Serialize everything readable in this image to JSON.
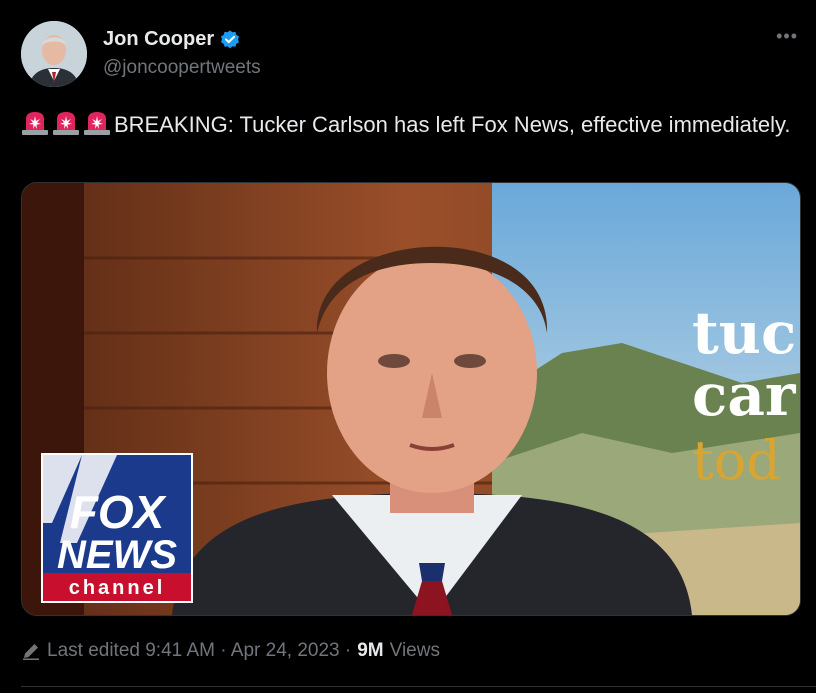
{
  "author": {
    "name": "Jon Cooper",
    "handle": "@joncoopertweets",
    "verified": true
  },
  "icons": {
    "more": "more-icon",
    "verified": "verified-badge-icon",
    "siren": "police-light-icon",
    "edit": "pencil-icon"
  },
  "tweet": {
    "text": "BREAKING: Tucker Carlson has left Fox News, effective immediately.",
    "siren_count": 3
  },
  "media": {
    "logo_line1": "FOX",
    "logo_line2": "NEWS",
    "logo_line3": "channel",
    "backdrop_text_line1": "tuc",
    "backdrop_text_line2": "car",
    "backdrop_text_line3": "tod"
  },
  "meta": {
    "edited": "Last edited 9:41 AM · Apr 24, 2023 ·",
    "views_count": "9M",
    "views_label": "Views"
  },
  "colors": {
    "background": "#000000",
    "text": "#e7e9ea",
    "secondary": "#71767b",
    "verified": "#1d9bf0",
    "fox_blue": "#1b3a8c",
    "fox_red": "#c8102e"
  }
}
